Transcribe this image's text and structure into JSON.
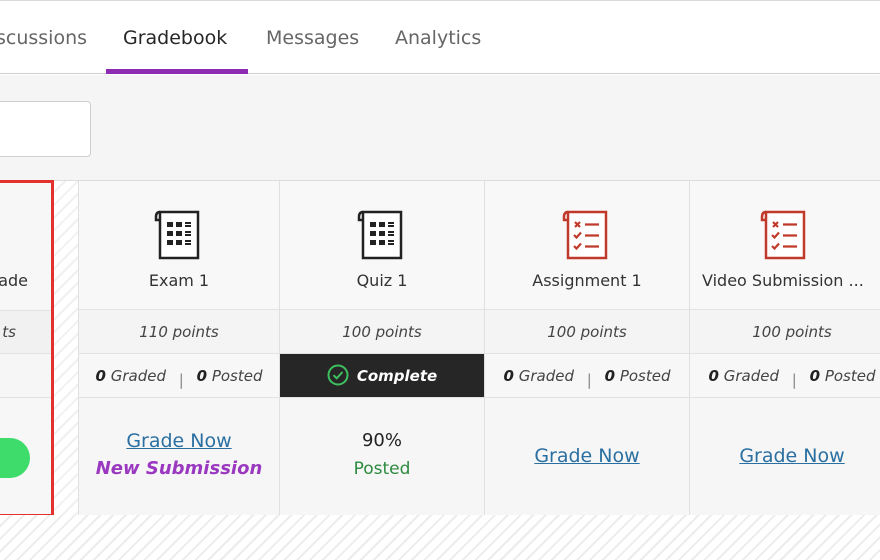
{
  "tabs": [
    {
      "label": "scussions",
      "active": false
    },
    {
      "label": "Gradebook",
      "active": true
    },
    {
      "label": "Messages",
      "active": false
    },
    {
      "label": "Analytics",
      "active": false
    }
  ],
  "left_column": {
    "title": "ade",
    "points": "ts"
  },
  "columns": [
    {
      "title": "Exam 1",
      "icon": "test-icon",
      "points": "110 points",
      "graded_count": "0",
      "graded_label": "Graded",
      "posted_count": "0",
      "posted_label": "Posted",
      "grade_link": "Grade Now",
      "new_submission": "New Submission"
    },
    {
      "title": "Quiz 1",
      "icon": "test-icon",
      "points": "100 points",
      "status": "Complete",
      "score": "90%",
      "score_status": "Posted"
    },
    {
      "title": "Assignment 1",
      "icon": "assignment-icon",
      "points": "100 points",
      "graded_count": "0",
      "graded_label": "Graded",
      "posted_count": "0",
      "posted_label": "Posted",
      "grade_link": "Grade Now"
    },
    {
      "title": "Video Submission ...",
      "icon": "assignment-icon",
      "points": "100 points",
      "graded_count": "0",
      "graded_label": "Graded",
      "posted_count": "0",
      "posted_label": "Posted",
      "grade_link": "Grade Now"
    }
  ],
  "colors": {
    "accent": "#8d2bb2",
    "highlight": "#e3322e",
    "toggle": "#3ddc6b",
    "link": "#2a6fa1",
    "posted": "#2c8a3e"
  }
}
